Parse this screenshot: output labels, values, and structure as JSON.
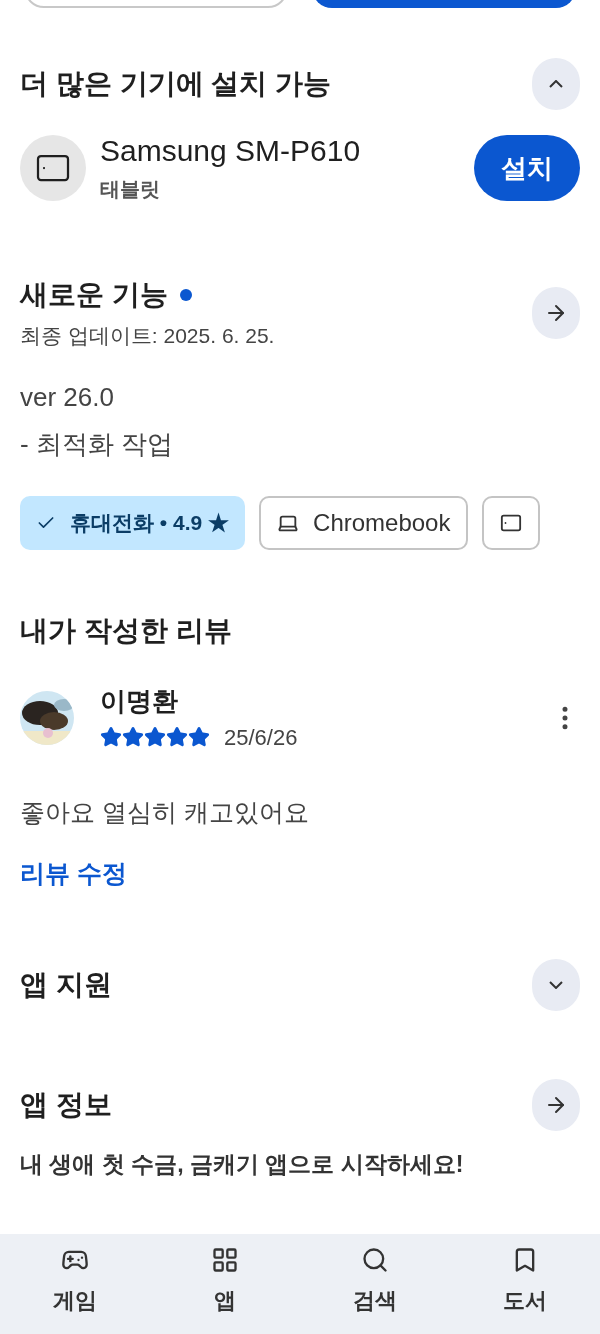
{
  "install_more": {
    "title": "더 많은 기기에 설치 가능",
    "expanded": true,
    "devices": [
      {
        "name": "Samsung SM-P610",
        "type": "태블릿",
        "button": "설치"
      }
    ]
  },
  "whats_new": {
    "title": "새로운 기능",
    "new_dot": true,
    "updated": "최종 업데이트: 2025. 6. 25.",
    "lines": [
      "ver 26.0",
      "- 최적화 작업"
    ]
  },
  "device_chips": [
    {
      "kind": "phone",
      "label": "휴대전화 • 4.9 ★",
      "selected": true
    },
    {
      "kind": "laptop",
      "label": "Chromebook",
      "selected": false
    },
    {
      "kind": "tablet",
      "selected": false
    }
  ],
  "my_review": {
    "title": "내가 작성한 리뷰",
    "author": "이명환",
    "stars": 5,
    "date": "25/6/26",
    "text": "좋아요 열심히 캐고있어요",
    "edit_link": "리뷰 수정"
  },
  "app_support": {
    "title": "앱 지원",
    "expanded": false
  },
  "app_info": {
    "title": "앱 정보",
    "teaser": "내 생애 첫 수금, 금캐기 앱으로 시작하세요!"
  },
  "bottom_nav": [
    {
      "kind": "games",
      "label": "게임"
    },
    {
      "kind": "apps",
      "label": "앱"
    },
    {
      "kind": "search",
      "label": "검색"
    },
    {
      "kind": "books",
      "label": "도서"
    }
  ]
}
